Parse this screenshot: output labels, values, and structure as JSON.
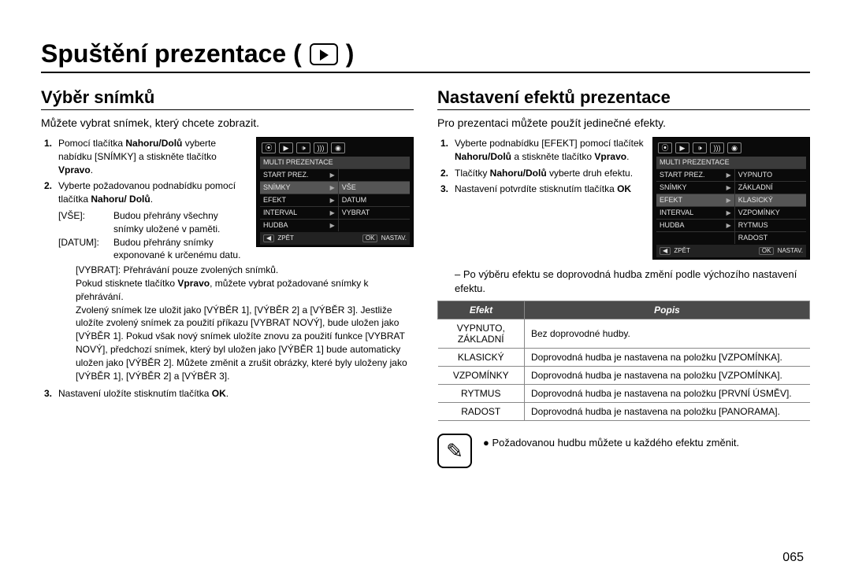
{
  "page_title": "Spuštění prezentace (",
  "page_title_close": ")",
  "page_number": "065",
  "left": {
    "heading": "Výběr snímků",
    "intro": "Můžete vybrat snímek, který chcete zobrazit.",
    "step1_pre": "Pomocí tlačítka ",
    "step1_b1": "Nahoru/Dolů",
    "step1_mid": " vyberte nabídku [SNÍMKY] a stiskněte tlačítko ",
    "step1_b2": "Vpravo",
    "step1_post": ".",
    "step2_pre": "Vyberte požadovanou podnabídku pomocí tlačítka ",
    "step2_b": "Nahoru/ Dolů",
    "step2_post": ".",
    "def_vse_k": "[VŠE]:",
    "def_vse_v": "Budou přehrány všechny snímky uložené v paměti.",
    "def_datum_k": "[DATUM]:",
    "def_datum_v": "Budou přehrány snímky exponované k určenému datu.",
    "def_vybrat_k": "[VYBRAT]:",
    "def_vybrat_v": "Přehrávání pouze zvolených snímků.",
    "vybrat_extra1_a": "Pokud stisknete tlačítko ",
    "vybrat_extra1_b": "Vpravo",
    "vybrat_extra1_c": ", můžete vybrat požadované snímky k přehrávání.",
    "vybrat_extra2": "Zvolený snímek lze uložit jako [VÝBĚR 1], [VÝBĚR 2] a [VÝBĚR 3]. Jestliže uložíte zvolený snímek za použití příkazu [VYBRAT NOVÝ], bude uložen jako [VÝBĚR 1]. Pokud však nový snímek uložíte znovu za použití funkce [VYBRAT NOVÝ], předchozí snímek, který byl uložen jako [VÝBĚR 1] bude automaticky uložen jako [VÝBĚR 2]. Můžete změnit a zrušit obrázky, které byly uloženy jako [VÝBĚR 1], [VÝBĚR 2] a [VÝBĚR 3].",
    "step3_pre": "Nastavení uložíte stisknutím tlačítka ",
    "step3_b": "OK",
    "step3_post": ".",
    "cam": {
      "header": "MULTI PREZENTACE",
      "rows": [
        {
          "l": "START PREZ.",
          "r": ""
        },
        {
          "l": "SNÍMKY",
          "r": "VŠE",
          "hl": true
        },
        {
          "l": "EFEKT",
          "r": "DATUM"
        },
        {
          "l": "INTERVAL",
          "r": "VYBRAT"
        },
        {
          "l": "HUDBA",
          "r": ""
        }
      ],
      "foot_l": "◀  ZPĚT",
      "foot_r": "OK  NASTAV."
    }
  },
  "right": {
    "heading": "Nastavení efektů prezentace",
    "intro": "Pro prezentaci můžete použít jedinečné efekty.",
    "step1_pre": "Vyberte podnabídku [EFEKT] pomocí tlačítek ",
    "step1_b1": "Nahoru/Dolů",
    "step1_mid": " a stiskněte tlačítko ",
    "step1_b2": "Vpravo",
    "step1_post": ".",
    "step2_pre": "Tlačítky ",
    "step2_b": "Nahoru/Dolů",
    "step2_post": " vyberte druh efektu.",
    "step3_pre": "Nastavení potvrdíte stisknutím tlačítka ",
    "step3_b": "OK",
    "after": "–  Po výběru efektu se doprovodná hudba změní podle výchozího nastavení efektu.",
    "table": {
      "h1": "Efekt",
      "h2": "Popis",
      "rows": [
        {
          "k": "VYPNUTO, ZÁKLADNÍ",
          "v": "Bez doprovodné hudby."
        },
        {
          "k": "KLASICKÝ",
          "v": "Doprovodná hudba je nastavena na položku [VZPOMÍNKA]."
        },
        {
          "k": "VZPOMÍNKY",
          "v": "Doprovodná hudba je nastavena na položku [VZPOMÍNKA]."
        },
        {
          "k": "RYTMUS",
          "v": "Doprovodná hudba je nastavena na položku [PRVNÍ ÚSMĚV]."
        },
        {
          "k": "RADOST",
          "v": "Doprovodná hudba je nastavena na položku [PANORAMA]."
        }
      ]
    },
    "note": "Požadovanou hudbu můžete u každého efektu změnit.",
    "cam": {
      "header": "MULTI PREZENTACE",
      "rows": [
        {
          "l": "START PREZ.",
          "r": "VYPNUTO"
        },
        {
          "l": "SNÍMKY",
          "r": "ZÁKLADNÍ"
        },
        {
          "l": "EFEKT",
          "r": "KLASICKÝ",
          "hl": true
        },
        {
          "l": "INTERVAL",
          "r": "VZPOMÍNKY"
        },
        {
          "l": "HUDBA",
          "r": "RYTMUS"
        },
        {
          "l": "",
          "r": "RADOST"
        }
      ],
      "foot_l": "◀  ZPĚT",
      "foot_r": "OK  NASTAV."
    }
  }
}
